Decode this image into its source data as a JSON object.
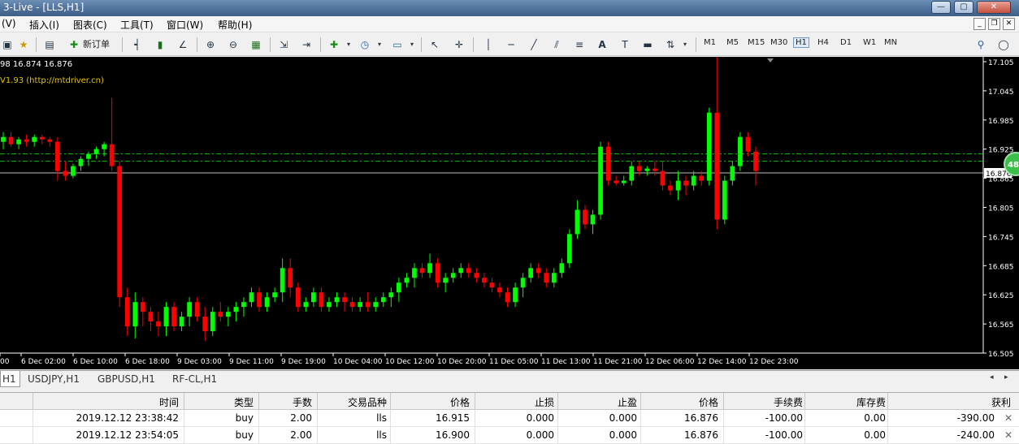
{
  "window": {
    "title": "3-Live - [LLS,H1]",
    "controls": [
      "—",
      "▢",
      "✕"
    ]
  },
  "menu": [
    {
      "label": "(V)"
    },
    {
      "label": "插入(I)"
    },
    {
      "label": "图表(C)"
    },
    {
      "label": "工具(T)"
    },
    {
      "label": "窗口(W)"
    },
    {
      "label": "帮助(H)"
    }
  ],
  "mdi_controls": [
    "_",
    "❐",
    "✕"
  ],
  "toolbar": {
    "new_order_label": "新订单",
    "timeframes": [
      "M1",
      "M5",
      "M15",
      "M30",
      "H1",
      "H4",
      "D1",
      "W1",
      "MN"
    ],
    "active_timeframe": "H1",
    "text_tool": "A"
  },
  "chart": {
    "ohlc_text": "98 16.874 16.876",
    "indicator_text": "V1.93 (http://mtdriver.cn)",
    "current_price_label": "16.876",
    "badge": "48",
    "colors": {
      "bull": "#00ff00",
      "bear": "#ff0000",
      "background": "#000000",
      "level_line": "#00cc00"
    }
  },
  "chart_data": {
    "type": "candlestick",
    "price_ticks": [
      "17.105",
      "17.045",
      "16.985",
      "16.925",
      "16.865",
      "16.805",
      "16.745",
      "16.685",
      "16.625",
      "16.565",
      "16.505"
    ],
    "time_ticks": [
      "00",
      "6 Dec 02:00",
      "6 Dec 10:00",
      "6 Dec 18:00",
      "9 Dec 03:00",
      "9 Dec 11:00",
      "9 Dec 19:00",
      "10 Dec 04:00",
      "10 Dec 12:00",
      "10 Dec 20:00",
      "11 Dec 05:00",
      "11 Dec 13:00",
      "11 Dec 21:00",
      "12 Dec 06:00",
      "12 Dec 14:00",
      "12 Dec 23:00"
    ],
    "ylim": [
      16.505,
      17.105
    ],
    "levels": [
      16.915,
      16.9
    ],
    "current_price": 16.876,
    "candles": [
      [
        16.94,
        16.96,
        16.925,
        16.95
      ],
      [
        16.95,
        16.96,
        16.93,
        16.935
      ],
      [
        16.935,
        16.95,
        16.925,
        16.945
      ],
      [
        16.945,
        16.955,
        16.93,
        16.94
      ],
      [
        16.94,
        16.955,
        16.93,
        16.95
      ],
      [
        16.95,
        16.955,
        16.935,
        16.945
      ],
      [
        16.945,
        16.95,
        16.93,
        16.94
      ],
      [
        16.94,
        16.95,
        16.86,
        16.88
      ],
      [
        16.88,
        16.9,
        16.86,
        16.87
      ],
      [
        16.87,
        16.895,
        16.865,
        16.89
      ],
      [
        16.89,
        16.91,
        16.88,
        16.905
      ],
      [
        16.905,
        16.92,
        16.89,
        16.915
      ],
      [
        16.915,
        16.93,
        16.905,
        16.925
      ],
      [
        16.925,
        16.94,
        16.91,
        16.935
      ],
      [
        16.935,
        17.03,
        16.88,
        16.89
      ],
      [
        16.89,
        16.9,
        16.6,
        16.62
      ],
      [
        16.62,
        16.64,
        16.54,
        16.56
      ],
      [
        16.56,
        16.63,
        16.535,
        16.61
      ],
      [
        16.61,
        16.62,
        16.56,
        16.59
      ],
      [
        16.59,
        16.6,
        16.55,
        16.57
      ],
      [
        16.57,
        16.59,
        16.54,
        16.56
      ],
      [
        16.56,
        16.61,
        16.54,
        16.6
      ],
      [
        16.6,
        16.61,
        16.55,
        16.56
      ],
      [
        16.56,
        16.59,
        16.55,
        16.58
      ],
      [
        16.58,
        16.62,
        16.56,
        16.61
      ],
      [
        16.61,
        16.62,
        16.57,
        16.58
      ],
      [
        16.58,
        16.6,
        16.53,
        16.55
      ],
      [
        16.55,
        16.6,
        16.54,
        16.59
      ],
      [
        16.59,
        16.61,
        16.57,
        16.58
      ],
      [
        16.58,
        16.6,
        16.56,
        16.59
      ],
      [
        16.59,
        16.61,
        16.57,
        16.6
      ],
      [
        16.6,
        16.62,
        16.58,
        16.61
      ],
      [
        16.61,
        16.64,
        16.6,
        16.63
      ],
      [
        16.63,
        16.64,
        16.59,
        16.6
      ],
      [
        16.6,
        16.63,
        16.59,
        16.62
      ],
      [
        16.62,
        16.64,
        16.61,
        16.63
      ],
      [
        16.63,
        16.7,
        16.61,
        16.68
      ],
      [
        16.68,
        16.7,
        16.62,
        16.64
      ],
      [
        16.64,
        16.65,
        16.59,
        16.6
      ],
      [
        16.6,
        16.62,
        16.59,
        16.61
      ],
      [
        16.61,
        16.64,
        16.6,
        16.63
      ],
      [
        16.63,
        16.64,
        16.59,
        16.6
      ],
      [
        16.6,
        16.62,
        16.59,
        16.61
      ],
      [
        16.61,
        16.63,
        16.6,
        16.62
      ],
      [
        16.62,
        16.63,
        16.59,
        16.61
      ],
      [
        16.61,
        16.62,
        16.59,
        16.6
      ],
      [
        16.6,
        16.62,
        16.59,
        16.61
      ],
      [
        16.61,
        16.63,
        16.59,
        16.6
      ],
      [
        16.6,
        16.62,
        16.59,
        16.61
      ],
      [
        16.61,
        16.63,
        16.6,
        16.62
      ],
      [
        16.62,
        16.64,
        16.6,
        16.63
      ],
      [
        16.63,
        16.66,
        16.61,
        16.65
      ],
      [
        16.65,
        16.67,
        16.64,
        16.66
      ],
      [
        16.66,
        16.69,
        16.64,
        16.68
      ],
      [
        16.68,
        16.69,
        16.66,
        16.67
      ],
      [
        16.67,
        16.71,
        16.66,
        16.69
      ],
      [
        16.69,
        16.7,
        16.64,
        16.65
      ],
      [
        16.65,
        16.67,
        16.63,
        16.66
      ],
      [
        16.66,
        16.68,
        16.65,
        16.67
      ],
      [
        16.67,
        16.69,
        16.66,
        16.68
      ],
      [
        16.68,
        16.69,
        16.66,
        16.67
      ],
      [
        16.67,
        16.68,
        16.65,
        16.66
      ],
      [
        16.66,
        16.67,
        16.64,
        16.65
      ],
      [
        16.65,
        16.66,
        16.63,
        16.64
      ],
      [
        16.64,
        16.65,
        16.62,
        16.63
      ],
      [
        16.63,
        16.64,
        16.6,
        16.61
      ],
      [
        16.61,
        16.65,
        16.6,
        16.64
      ],
      [
        16.64,
        16.67,
        16.62,
        16.66
      ],
      [
        16.66,
        16.69,
        16.65,
        16.68
      ],
      [
        16.68,
        16.69,
        16.66,
        16.67
      ],
      [
        16.67,
        16.68,
        16.64,
        16.65
      ],
      [
        16.65,
        16.68,
        16.64,
        16.67
      ],
      [
        16.67,
        16.7,
        16.66,
        16.69
      ],
      [
        16.69,
        16.76,
        16.68,
        16.75
      ],
      [
        16.75,
        16.82,
        16.74,
        16.8
      ],
      [
        16.8,
        16.81,
        16.76,
        16.77
      ],
      [
        16.77,
        16.8,
        16.75,
        16.79
      ],
      [
        16.79,
        16.94,
        16.78,
        16.93
      ],
      [
        16.93,
        16.94,
        16.85,
        16.86
      ],
      [
        16.86,
        16.87,
        16.85,
        16.855
      ],
      [
        16.855,
        16.87,
        16.85,
        16.86
      ],
      [
        16.86,
        16.9,
        16.85,
        16.89
      ],
      [
        16.89,
        16.9,
        16.87,
        16.88
      ],
      [
        16.88,
        16.89,
        16.87,
        16.885
      ],
      [
        16.885,
        16.9,
        16.87,
        16.88
      ],
      [
        16.88,
        16.9,
        16.84,
        16.85
      ],
      [
        16.85,
        16.86,
        16.83,
        16.84
      ],
      [
        16.84,
        16.88,
        16.82,
        16.86
      ],
      [
        16.86,
        16.87,
        16.83,
        16.85
      ],
      [
        16.85,
        16.88,
        16.84,
        16.87
      ],
      [
        16.87,
        16.88,
        16.85,
        16.86
      ],
      [
        16.86,
        17.01,
        16.85,
        17.0
      ],
      [
        17.0,
        17.12,
        16.76,
        16.78
      ],
      [
        16.78,
        16.87,
        16.77,
        16.86
      ],
      [
        16.86,
        16.9,
        16.85,
        16.89
      ],
      [
        16.89,
        16.96,
        16.88,
        16.95
      ],
      [
        16.95,
        16.96,
        16.91,
        16.92
      ],
      [
        16.92,
        16.93,
        16.85,
        16.88
      ]
    ]
  },
  "tabs": [
    {
      "label": "H1",
      "active": true
    },
    {
      "label": "USDJPY,H1",
      "active": false
    },
    {
      "label": "GBPUSD,H1",
      "active": false
    },
    {
      "label": "RF-CL,H1",
      "active": false
    }
  ],
  "trade_table": {
    "headers": [
      "时间",
      "类型",
      "手数",
      "交易品种",
      "价格",
      "止损",
      "止盈",
      "价格",
      "手续费",
      "库存费",
      "获利"
    ],
    "rows": [
      [
        "2019.12.12 23:38:42",
        "buy",
        "2.00",
        "lls",
        "16.915",
        "0.000",
        "0.000",
        "16.876",
        "-100.00",
        "0.00",
        "-390.00"
      ],
      [
        "2019.12.12 23:54:05",
        "buy",
        "2.00",
        "lls",
        "16.900",
        "0.000",
        "0.000",
        "16.876",
        "-100.00",
        "0.00",
        "-240.00"
      ]
    ]
  }
}
